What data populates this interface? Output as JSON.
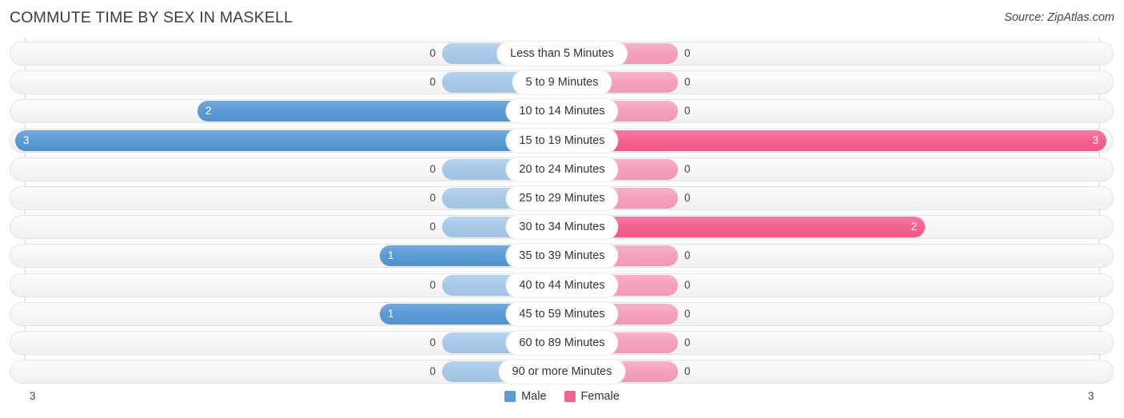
{
  "header": {
    "title": "COMMUTE TIME BY SEX IN MASKELL",
    "source": "Source: ZipAtlas.com"
  },
  "legend": {
    "male_label": "Male",
    "female_label": "Female",
    "male_color": "#5b9bd5",
    "female_color": "#f4628f"
  },
  "axis": {
    "left_min": "3",
    "right_max": "3"
  },
  "chart_data": {
    "type": "bar",
    "title": "COMMUTE TIME BY SEX IN MASKELL",
    "subtitle": "Source: ZipAtlas.com",
    "orientation": "horizontal",
    "style": "diverging-bidirectional",
    "xlabel": "",
    "ylabel": "",
    "xlim": [
      3,
      3
    ],
    "grid": true,
    "legend_position": "bottom-center",
    "categories": [
      "Less than 5 Minutes",
      "5 to 9 Minutes",
      "10 to 14 Minutes",
      "15 to 19 Minutes",
      "20 to 24 Minutes",
      "25 to 29 Minutes",
      "30 to 34 Minutes",
      "35 to 39 Minutes",
      "40 to 44 Minutes",
      "45 to 59 Minutes",
      "60 to 89 Minutes",
      "90 or more Minutes"
    ],
    "series": [
      {
        "name": "Male",
        "direction": "left",
        "color": "#5b9bd5",
        "values": [
          0,
          0,
          2,
          3,
          0,
          0,
          0,
          1,
          0,
          1,
          0,
          0
        ],
        "labels": [
          "0",
          "0",
          "2",
          "3",
          "0",
          "0",
          "0",
          "1",
          "0",
          "1",
          "0",
          "0"
        ]
      },
      {
        "name": "Female",
        "direction": "right",
        "color": "#f4628f",
        "values": [
          0,
          0,
          0,
          3,
          0,
          0,
          2,
          0,
          0,
          0,
          0,
          0
        ],
        "labels": [
          "0",
          "0",
          "0",
          "3",
          "0",
          "0",
          "2",
          "0",
          "0",
          "0",
          "0",
          "0"
        ]
      }
    ],
    "max_value": 3
  }
}
